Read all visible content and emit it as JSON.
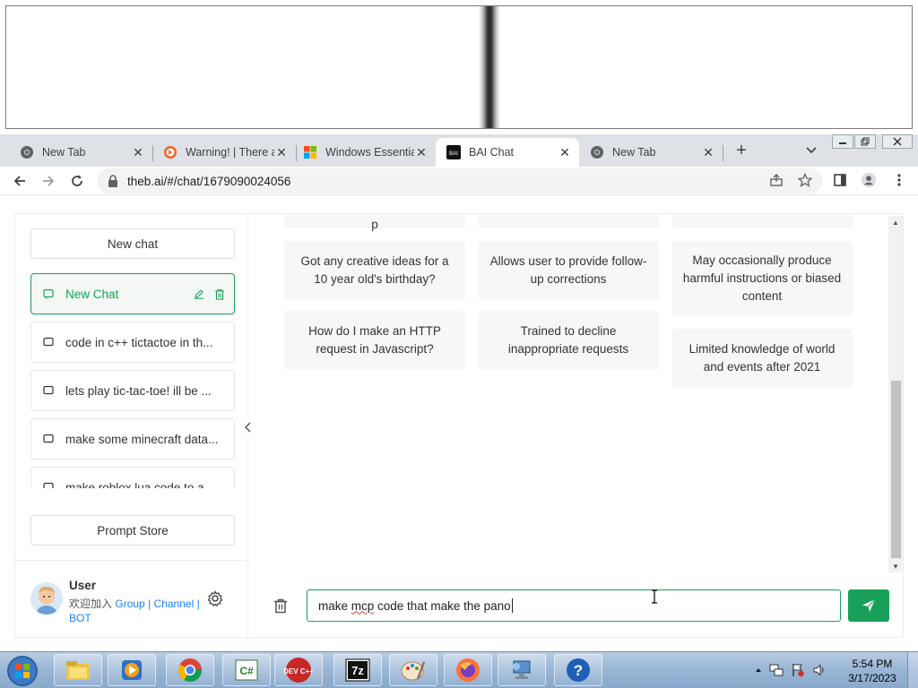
{
  "browser": {
    "tabs": [
      {
        "title": "New Tab",
        "favicon": "chrome-icon",
        "active": false
      },
      {
        "title": "Warning! | There a",
        "favicon": "brave-icon",
        "active": false
      },
      {
        "title": "Windows Essentia",
        "favicon": "microsoft-icon",
        "active": false
      },
      {
        "title": "BAI Chat",
        "favicon": "bai-icon",
        "active": true
      },
      {
        "title": "New Tab",
        "favicon": "chrome-icon",
        "active": false
      }
    ],
    "close_glyph": "✕",
    "new_tab_glyph": "+",
    "url": "theb.ai/#/chat/1679090024056",
    "window_controls": [
      "minimize",
      "restore",
      "close"
    ]
  },
  "sidebar": {
    "new_chat_label": "New chat",
    "chats": [
      {
        "title": "New Chat",
        "active": true
      },
      {
        "title": "code in c++ tictactoe in th..."
      },
      {
        "title": "lets play tic-tac-toe! ill be ..."
      },
      {
        "title": "make some minecraft data..."
      },
      {
        "title": "make roblox lua code to a..."
      }
    ],
    "prompt_store_label": "Prompt Store",
    "user": {
      "name": "User",
      "join_prefix": "欢迎加入",
      "group": "Group",
      "sep1": "|",
      "channel": "Channel",
      "sep2": "|",
      "bot": "BOT"
    }
  },
  "main": {
    "partial_top_text": "p",
    "cards": [
      {
        "text": "Got any creative ideas for a 10 year old's birthday?"
      },
      {
        "text": "Allows user to provide follow-up corrections"
      },
      {
        "text": "May occasionally produce harmful instructions or biased content"
      },
      {
        "text": "How do I make an HTTP request in Javascript?"
      },
      {
        "text": "Trained to decline inappropriate requests"
      },
      {
        "text": "Limited knowledge of world and events after 2021"
      }
    ],
    "input": {
      "before": "make ",
      "misspelled": "mcp",
      "after": " code that make the pano"
    }
  },
  "taskbar": {
    "apps": [
      "explorer-icon",
      "media-player-icon",
      "chrome-icon",
      "csharp-icon",
      "devcpp-icon",
      "7zip-icon",
      "paint-icon",
      "firefox-icon",
      "network-icon",
      "help-icon"
    ],
    "devcpp_label": "DEV C++",
    "csharp_label": "C#",
    "sevenzip_label": "7z",
    "time": "5:54 PM",
    "date": "3/17/2023"
  },
  "colors": {
    "accent": "#18a058",
    "link": "#2080f0",
    "card_bg": "#f7f7f8"
  }
}
